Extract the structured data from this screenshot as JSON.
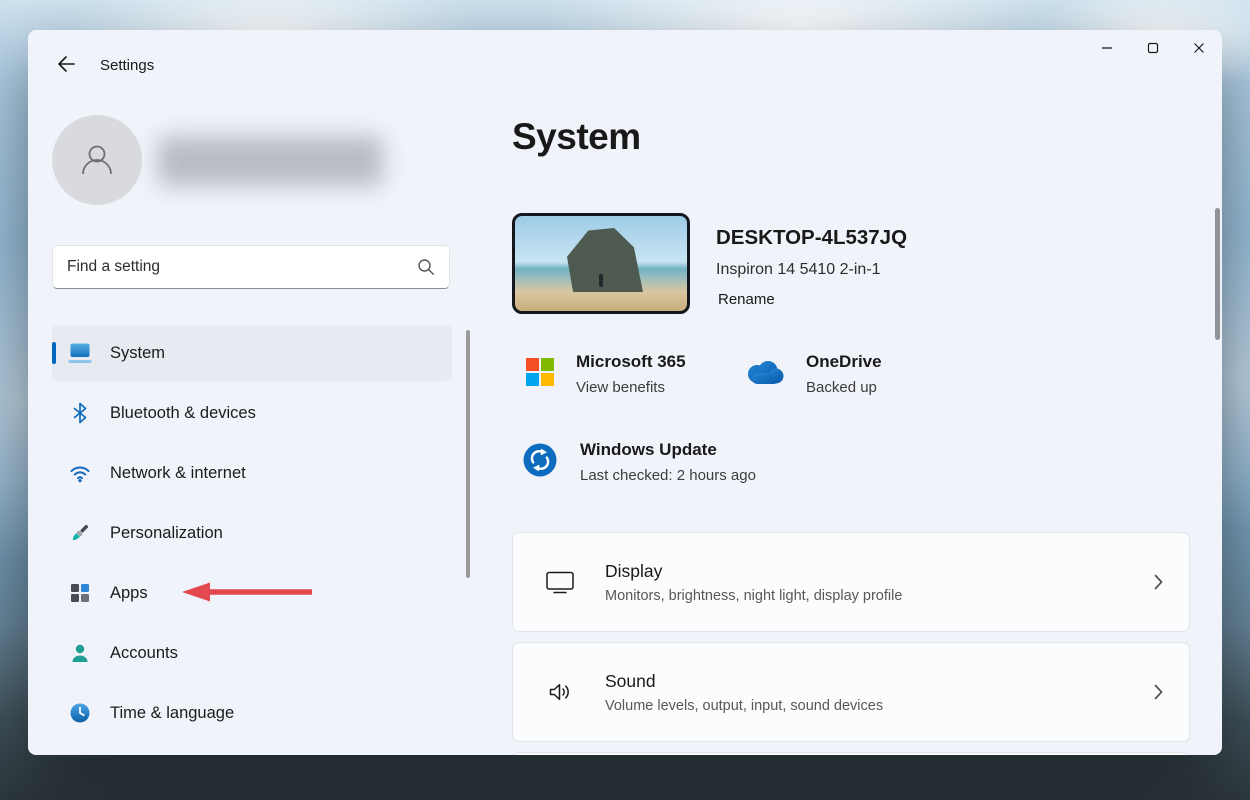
{
  "colors": {
    "accent": "#0067c0",
    "annotation_arrow": "#e2484d"
  },
  "titlebar": {
    "app_title": "Settings"
  },
  "sidebar": {
    "search_placeholder": "Find a setting",
    "items": [
      {
        "label": "System",
        "icon": "system-icon",
        "selected": true
      },
      {
        "label": "Bluetooth & devices",
        "icon": "bluetooth-icon",
        "selected": false
      },
      {
        "label": "Network & internet",
        "icon": "network-icon",
        "selected": false
      },
      {
        "label": "Personalization",
        "icon": "personalization-icon",
        "selected": false
      },
      {
        "label": "Apps",
        "icon": "apps-icon",
        "selected": false
      },
      {
        "label": "Accounts",
        "icon": "accounts-icon",
        "selected": false
      },
      {
        "label": "Time & language",
        "icon": "time-language-icon",
        "selected": false
      }
    ]
  },
  "main": {
    "page_title": "System",
    "device": {
      "name": "DESKTOP-4L537JQ",
      "model": "Inspiron 14 5410 2-in-1",
      "rename_label": "Rename"
    },
    "status_tiles": [
      {
        "title": "Microsoft 365",
        "subtitle": "View benefits",
        "icon": "microsoft-365-icon"
      },
      {
        "title": "OneDrive",
        "subtitle": "Backed up",
        "icon": "onedrive-icon"
      },
      {
        "title": "Windows Update",
        "subtitle": "Last checked: 2 hours ago",
        "icon": "windows-update-icon"
      }
    ],
    "settings_cards": [
      {
        "title": "Display",
        "subtitle": "Monitors, brightness, night light, display profile",
        "icon": "display-icon"
      },
      {
        "title": "Sound",
        "subtitle": "Volume levels, output, input, sound devices",
        "icon": "sound-icon"
      }
    ]
  },
  "annotation": {
    "type": "red-arrow",
    "points_to": "Apps"
  }
}
